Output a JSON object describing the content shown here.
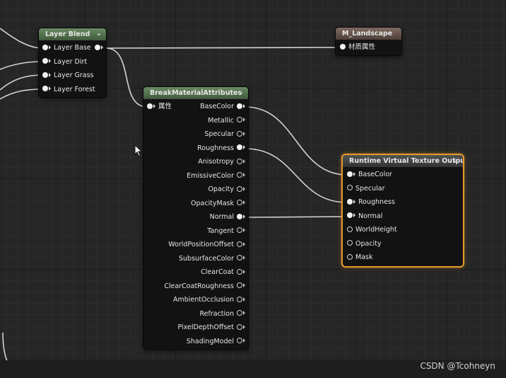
{
  "nodes": {
    "layer_blend": {
      "title": "Layer Blend",
      "outputs": [
        "Layer Base"
      ],
      "inputs": [
        "Layer Base",
        "Layer Dirt",
        "Layer Grass",
        "Layer Forest"
      ]
    },
    "m_landscape": {
      "title": "M_Landscape",
      "outputs": [
        "材质属性"
      ]
    },
    "break_material": {
      "title": "BreakMaterialAttributes",
      "input": "属性",
      "outputs": [
        "BaseColor",
        "Metallic",
        "Specular",
        "Roughness",
        "Anisotropy",
        "EmissiveColor",
        "Opacity",
        "OpacityMask",
        "Normal",
        "Tangent",
        "WorldPositionOffset",
        "SubsurfaceColor",
        "ClearCoat",
        "ClearCoatRoughness",
        "AmbientOcclusion",
        "Refraction",
        "PixelDepthOffset",
        "ShadingModel"
      ],
      "connected": [
        "BaseColor",
        "Roughness",
        "Normal"
      ]
    },
    "rvt_output": {
      "title": "Runtime Virtual Texture Output",
      "inputs": [
        "BaseColor",
        "Specular",
        "Roughness",
        "Normal",
        "WorldHeight",
        "Opacity",
        "Mask"
      ],
      "connected": [
        "BaseColor",
        "Roughness",
        "Normal"
      ]
    }
  },
  "colors": {
    "graph_bg": "#262626",
    "wire": "#e8e8e8",
    "header_green": "#4f6b48",
    "header_brown": "#5f4d45",
    "selection_orange": "#e69a2a"
  },
  "icons": [
    "collapse-chevron-icon",
    "pin-connected-icon",
    "pin-unconnected-icon",
    "mouse-cursor-icon"
  ],
  "watermark": "CSDN @Tcohneyn"
}
